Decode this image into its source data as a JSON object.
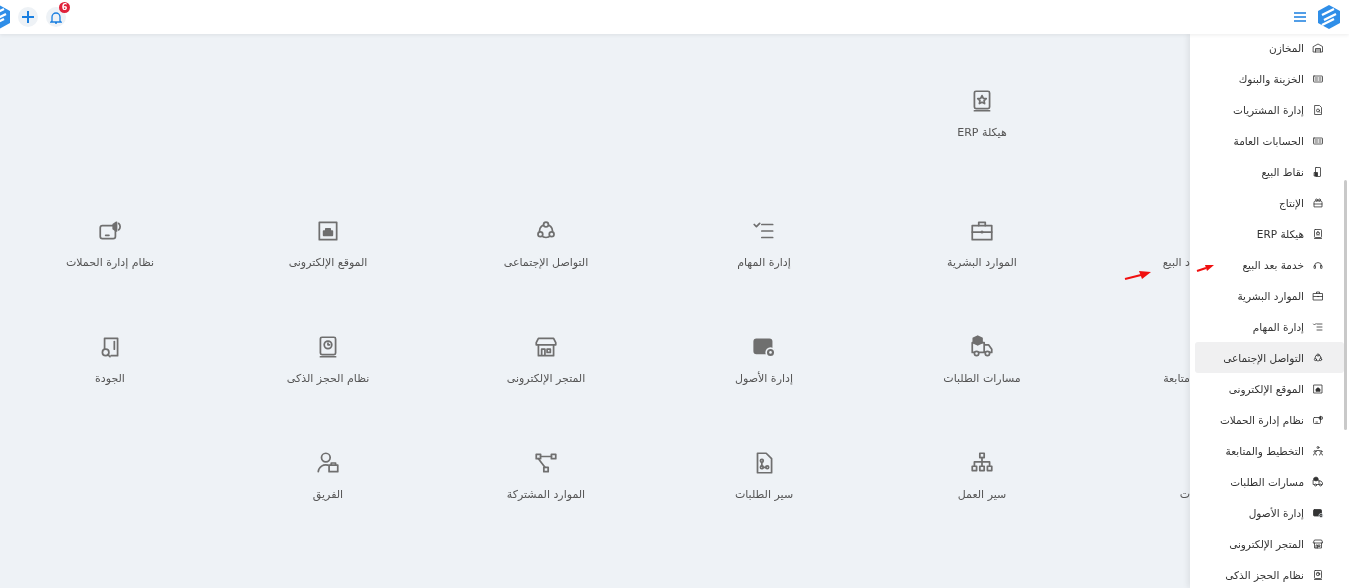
{
  "header": {
    "notification_count": "6"
  },
  "modules": [
    [
      {
        "kind": "blank"
      },
      {
        "kind": "module",
        "label": "هيكلة ERP"
      }
    ],
    [
      {
        "kind": "covered",
        "label": "د البيع"
      },
      {
        "kind": "module",
        "label": "الموارد البشرية"
      },
      {
        "kind": "module",
        "label": "إدارة المهام"
      },
      {
        "kind": "module",
        "label": "التواصل الإجتماعى"
      },
      {
        "kind": "module",
        "label": "الموقع الإلكترونى"
      },
      {
        "kind": "module",
        "label": "نظام إدارة الحملات"
      }
    ],
    [
      {
        "kind": "covered",
        "label": "متابعة"
      },
      {
        "kind": "module",
        "label": "مسارات الطلبات"
      },
      {
        "kind": "module",
        "label": "إدارة الأصول"
      },
      {
        "kind": "module",
        "label": "المتجر الإلكترونى"
      },
      {
        "kind": "module",
        "label": "نظام الحجز الذكى"
      },
      {
        "kind": "module",
        "label": "الجودة"
      }
    ],
    [
      {
        "kind": "covered",
        "label": "ت"
      },
      {
        "kind": "module",
        "label": "سير العمل"
      },
      {
        "kind": "module",
        "label": "سير الطلبات"
      },
      {
        "kind": "module",
        "label": "الموارد المشتركة"
      },
      {
        "kind": "module",
        "label": "الفريق"
      }
    ]
  ],
  "sidebar": {
    "items": [
      {
        "label": "المخازن",
        "selected": false
      },
      {
        "label": "الخزينة والبنوك",
        "selected": false
      },
      {
        "label": "إدارة المشتريات",
        "selected": false
      },
      {
        "label": "الحسابات العامة",
        "selected": false
      },
      {
        "label": "نقاط البيع",
        "selected": false
      },
      {
        "label": "الإنتاج",
        "selected": false
      },
      {
        "label": "هيكلة ERP",
        "selected": false
      },
      {
        "label": "خدمة بعد البيع",
        "selected": false
      },
      {
        "label": "الموارد البشرية",
        "selected": false
      },
      {
        "label": "إدارة المهام",
        "selected": false
      },
      {
        "label": "التواصل الإجتماعى",
        "selected": true
      },
      {
        "label": "الموقع الإلكترونى",
        "selected": false
      },
      {
        "label": "نظام إدارة الحملات",
        "selected": false
      },
      {
        "label": "التخطيط والمتابعة",
        "selected": false
      },
      {
        "label": "مسارات الطلبات",
        "selected": false
      },
      {
        "label": "إدارة الأصول",
        "selected": false
      },
      {
        "label": "المتجر الإلكترونى",
        "selected": false
      },
      {
        "label": "نظام الحجز الذكى",
        "selected": false
      }
    ]
  }
}
